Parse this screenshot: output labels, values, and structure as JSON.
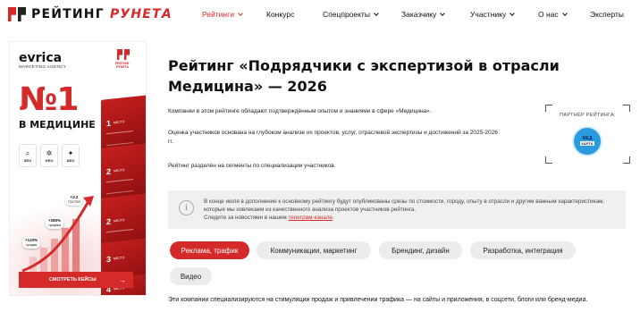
{
  "brand": {
    "logo_text_a": "РЕЙТИНГ",
    "logo_text_b": "РУНЕТА",
    "accent": "#d42a2a"
  },
  "nav": {
    "items": [
      {
        "label": "Рейтинги",
        "dropdown": true,
        "active": true
      },
      {
        "label": "Конкурс",
        "dropdown": false,
        "active": false
      },
      {
        "label": "Спецпроекты",
        "dropdown": true,
        "active": false
      },
      {
        "label": "Заказчику",
        "dropdown": true,
        "active": false
      },
      {
        "label": "Участнику",
        "dropdown": true,
        "active": false
      },
      {
        "label": "О нас",
        "dropdown": true,
        "active": false
      },
      {
        "label": "Эксперты",
        "dropdown": false,
        "active": false
      }
    ]
  },
  "banner": {
    "company": "evrica",
    "agency": "MARKETING AGENCY",
    "rating_logo_text": "РЕЙТИНГ РУНЕТА",
    "headline": "№1",
    "subheadline": "В МЕДИЦИНЕ",
    "icons": [
      {
        "icon": "search-icon",
        "glyph": "⌕",
        "label": "SEO"
      },
      {
        "icon": "sparkle-icon",
        "glyph": "✲",
        "label": "GEO"
      },
      {
        "icon": "star-icon",
        "glyph": "✦",
        "label": "AEO"
      }
    ],
    "cards": [
      {
        "num": "1",
        "label": "МЕСТО"
      },
      {
        "num": "2",
        "label": "МЕСТО"
      },
      {
        "num": "2",
        "label": "МЕСТО"
      },
      {
        "num": "3",
        "label": "МЕСТО"
      },
      {
        "num": "4",
        "label": "МЕСТО"
      }
    ],
    "badges": [
      {
        "value": "+3.2",
        "sub": "ГОСТЕЙ"
      },
      {
        "value": "+280%",
        "sub": "трафика"
      },
      {
        "value": "+120%",
        "sub": "продаж"
      }
    ],
    "cta": "СМОТРЕТЬ КЕЙСЫ",
    "cta_arrow": "→"
  },
  "page": {
    "title": "Рейтинг «Подрядчики с экспертизой в отрасли Медицина» — 2026",
    "p1": "Компании в этом рейтинге обладают подтверждённым опытом и знаниями в сфере «Медицина».",
    "p2": "Оценка участников основана на глубоком анализе их проектов, услуг, отраслевой экспертизы и достижений за 2025-2026 гг.",
    "p3": "Рейтинг разделён на сегменты по специализации участников."
  },
  "partner": {
    "label": "ПАРТНЁР РЕЙТИНГА:",
    "logo_line1": "МЕД",
    "logo_line2": "КАРТА",
    "logo_color": "#2a9be0"
  },
  "notice": {
    "text": "В конце июля в дополнение к основному рейтингу будут опубликованы срезы по стоимости, городу, опыту в отрасли и другим важным характеристикам, которые мы извлекаем из качественного анализа проектов участников рейтинга.",
    "text2": "Следите за новостями в нашем ",
    "link": "телеграм-канале",
    "text3": "."
  },
  "segments": [
    {
      "label": "Реклама, трафик",
      "active": true
    },
    {
      "label": "Коммуникации, маркетинг",
      "active": false
    },
    {
      "label": "Брендинг, дизайн",
      "active": false
    },
    {
      "label": "Разработка, интеграция",
      "active": false
    },
    {
      "label": "Видео",
      "active": false
    }
  ],
  "segment_description": "Эти компании специализируются на стимуляции продаж и привлечении трафика — на сайты и приложения, в соцсети, блоги или бренд-медиа."
}
